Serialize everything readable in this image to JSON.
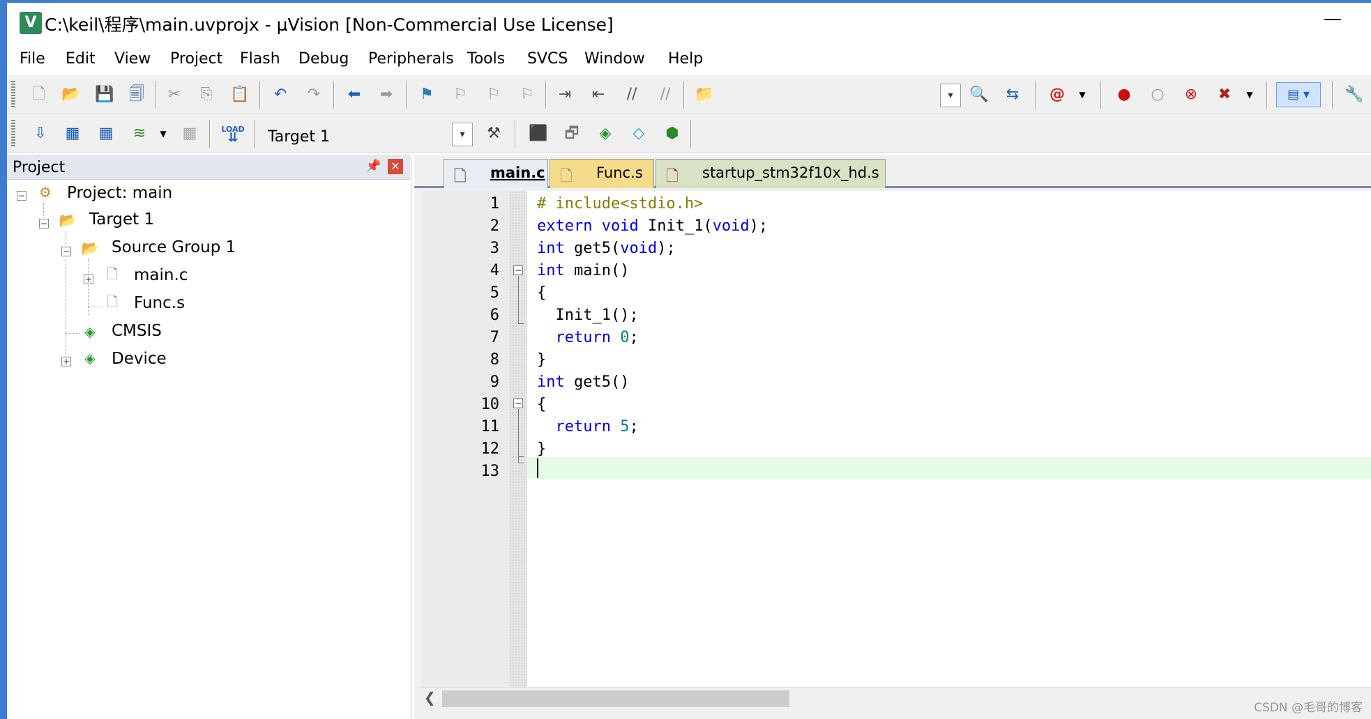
{
  "window": {
    "title": "C:\\keil\\程序\\main.uvprojx - µVision  [Non-Commercial Use License]",
    "minimize_glyph": "—"
  },
  "menu": [
    "File",
    "Edit",
    "View",
    "Project",
    "Flash",
    "Debug",
    "Peripherals",
    "Tools",
    "SVCS",
    "Window",
    "Help"
  ],
  "toolbar": {
    "target_label": "Target 1",
    "icons_row1": [
      "new-file-icon",
      "open-file-icon",
      "save-icon",
      "save-all-icon",
      "cut-icon",
      "copy-icon",
      "paste-icon",
      "undo-icon",
      "redo-icon",
      "navigate-back-icon",
      "navigate-forward-icon",
      "bookmark-icon",
      "prev-bookmark-icon",
      "next-bookmark-icon",
      "clear-bookmarks-icon",
      "indent-icon",
      "unindent-icon",
      "comment-icon",
      "uncomment-icon",
      "find-in-files-icon",
      "find-combo-dropdown-icon",
      "incremental-find-icon",
      "source-browser-icon",
      "debug-session-icon",
      "breakpoint-icon",
      "disable-breakpoint-icon",
      "disable-all-breakpoints-icon",
      "kill-all-breakpoints-icon",
      "window-layout-icon",
      "configure-icon"
    ],
    "icons_row2": [
      "translate-icon",
      "build-icon",
      "rebuild-icon",
      "batch-build-icon",
      "stop-build-icon",
      "download-icon",
      "target-options-icon",
      "file-extensions-icon",
      "manage-components-icon",
      "select-software-packs-icon",
      "pack-installer-icon"
    ]
  },
  "project_panel": {
    "title": "Project",
    "tree": {
      "root": "Project: main",
      "target": "Target 1",
      "group": "Source Group 1",
      "files": [
        "main.c",
        "Func.s"
      ],
      "cmsis": "CMSIS",
      "device": "Device"
    }
  },
  "tabs": [
    {
      "label": "main.c",
      "active": true
    },
    {
      "label": "Func.s",
      "active": false
    },
    {
      "label": "startup_stm32f10x_hd.s",
      "active": false
    }
  ],
  "code": {
    "line_numbers": [
      "1",
      "2",
      "3",
      "4",
      "5",
      "6",
      "7",
      "8",
      "9",
      "10",
      "11",
      "12",
      "13"
    ],
    "lines": [
      [
        {
          "t": "# include<stdio.h>",
          "c": "pp"
        }
      ],
      [
        {
          "t": "extern",
          "c": "kw"
        },
        {
          "t": " "
        },
        {
          "t": "void",
          "c": "kw"
        },
        {
          "t": " Init_1("
        },
        {
          "t": "void",
          "c": "kw"
        },
        {
          "t": ");"
        }
      ],
      [
        {
          "t": "int",
          "c": "kw"
        },
        {
          "t": " get5("
        },
        {
          "t": "void",
          "c": "kw"
        },
        {
          "t": ");"
        }
      ],
      [
        {
          "t": "int",
          "c": "kw"
        },
        {
          "t": " main()"
        }
      ],
      [
        {
          "t": "{"
        }
      ],
      [
        {
          "t": "  Init_1();"
        }
      ],
      [
        {
          "t": "  "
        },
        {
          "t": "return",
          "c": "kw"
        },
        {
          "t": " "
        },
        {
          "t": "0",
          "c": "num"
        },
        {
          "t": ";"
        }
      ],
      [
        {
          "t": "}"
        }
      ],
      [
        {
          "t": "int",
          "c": "kw"
        },
        {
          "t": " get5()"
        }
      ],
      [
        {
          "t": "{"
        }
      ],
      [
        {
          "t": "  "
        },
        {
          "t": "return",
          "c": "kw"
        },
        {
          "t": " "
        },
        {
          "t": "5",
          "c": "num"
        },
        {
          "t": ";"
        }
      ],
      [
        {
          "t": "}"
        }
      ],
      [
        {
          "t": ""
        }
      ]
    ],
    "current_line": 13
  },
  "watermark": "CSDN @毛哥的博客"
}
